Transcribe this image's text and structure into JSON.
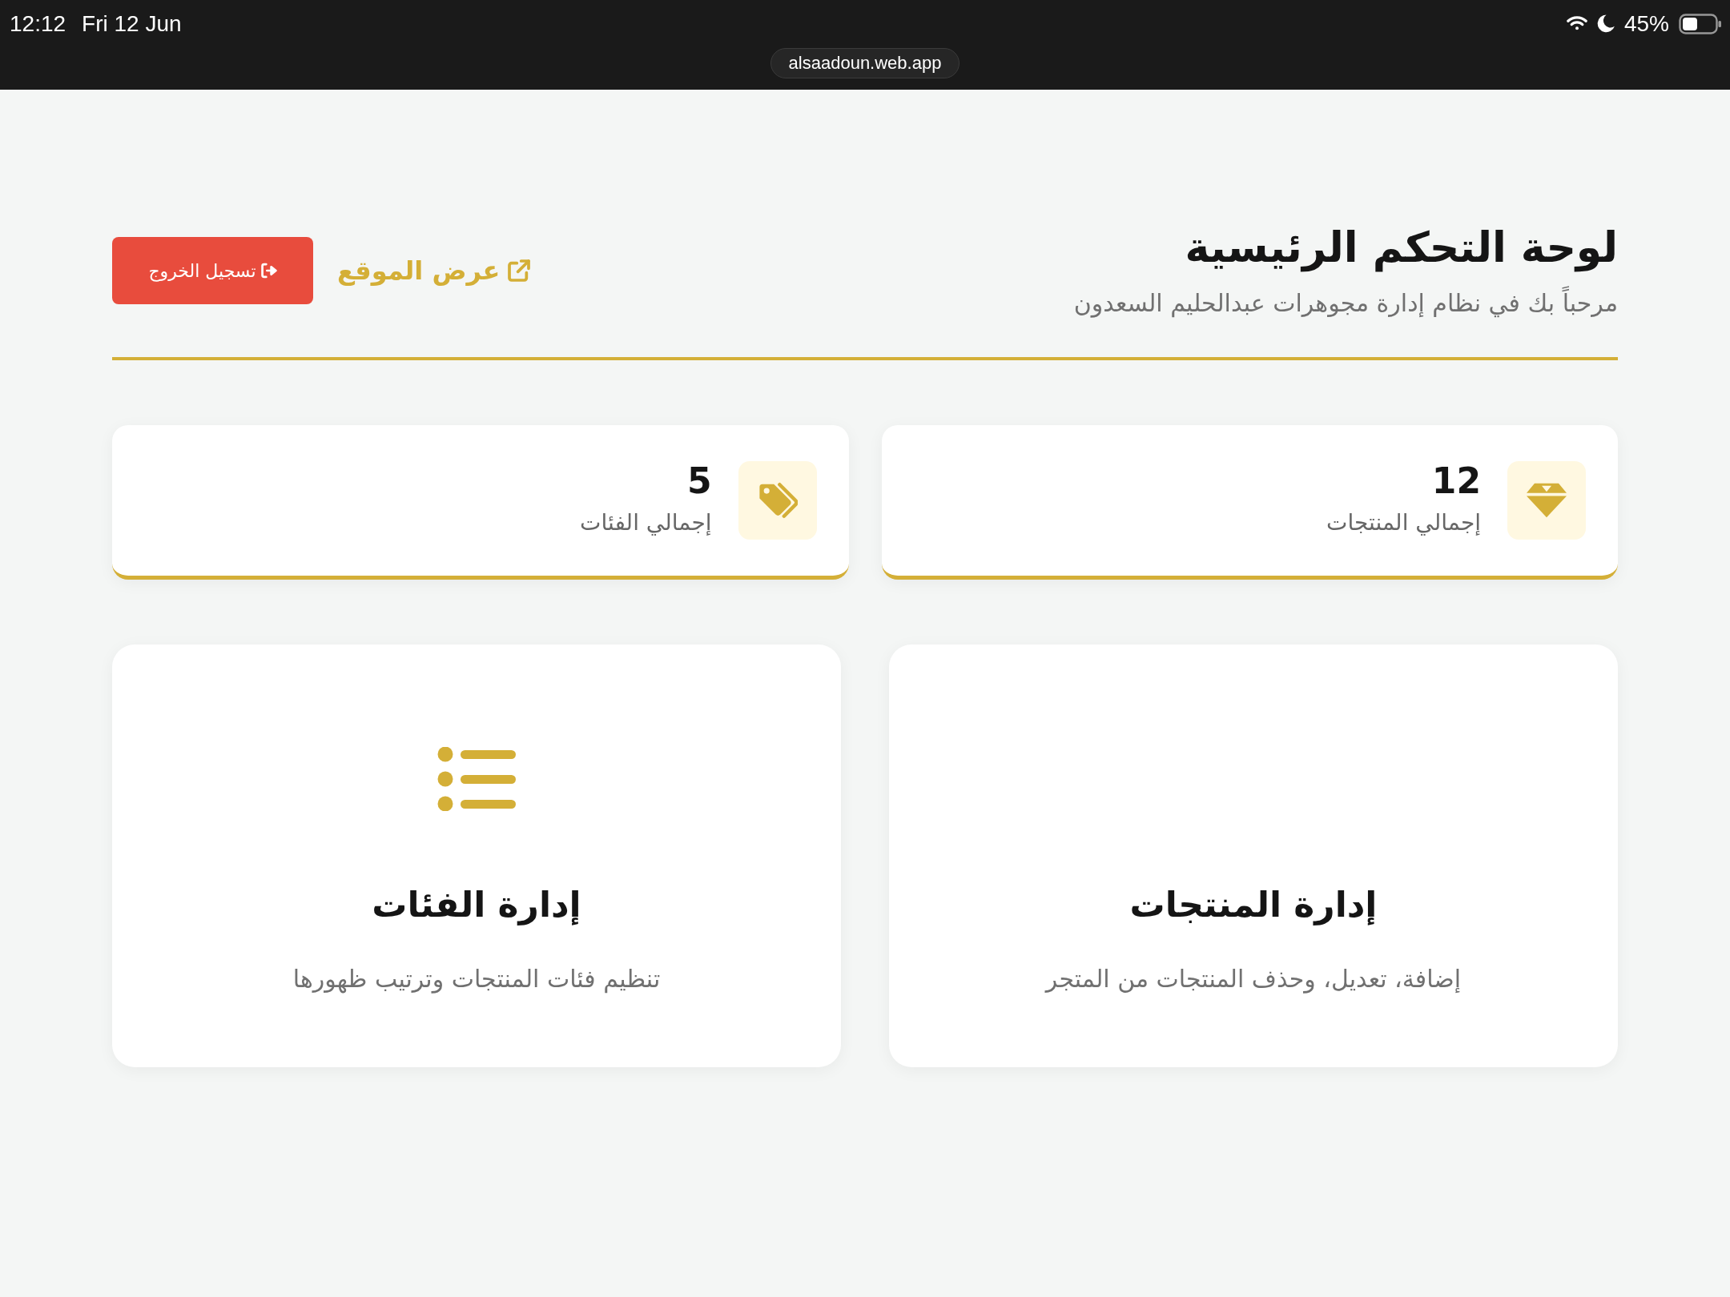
{
  "status_bar": {
    "time": "12:12",
    "date": "Fri 12 Jun",
    "battery": "45%",
    "url": "alsaadoun.web.app"
  },
  "header": {
    "title": "لوحة التحكم الرئيسية",
    "subtitle": "مرحباً بك في نظام إدارة مجوهرات عبدالحليم السعدون",
    "view_site_link": "عرض الموقع",
    "logout_button": "تسجيل الخروج"
  },
  "stats": [
    {
      "value": "12",
      "label": "إجمالي المنتجات"
    },
    {
      "value": "5",
      "label": "إجمالي الفئات"
    }
  ],
  "nav_cards": [
    {
      "title": "إدارة المنتجات",
      "description": "إضافة، تعديل، وحذف المنتجات من المتجر",
      "icon_visible": false
    },
    {
      "title": "إدارة الفئات",
      "description": "تنظيم فئات المنتجات وترتيب ظهورها",
      "icon_visible": true
    }
  ]
}
